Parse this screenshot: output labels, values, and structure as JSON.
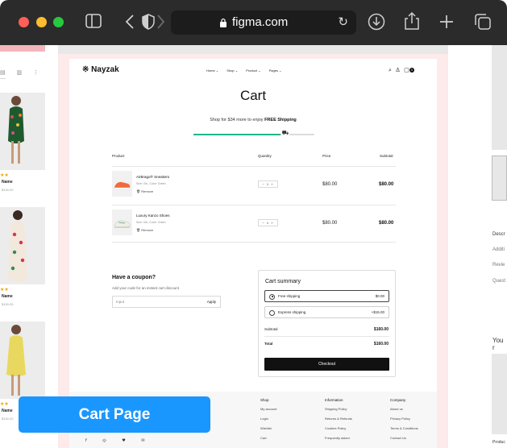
{
  "browser": {
    "url": "figma.com",
    "colors": {
      "close": "#ff5f57",
      "minimize": "#febc2e",
      "zoom": "#28c840"
    },
    "icons": [
      "sidebar-icon",
      "back-icon",
      "shield-icon",
      "forward-icon",
      "lock-icon",
      "reload-icon",
      "download-icon",
      "share-icon",
      "new-tab-icon",
      "tabs-icon"
    ]
  },
  "left_frame": {
    "products": [
      {
        "stars": "★★",
        "name": "Name",
        "price": "$100.00"
      },
      {
        "stars": "★★",
        "name": "Name",
        "price": "$100.00"
      },
      {
        "stars": "★★",
        "name": "Name",
        "price": "$100.00"
      }
    ]
  },
  "header": {
    "logo": "※ Nayzak",
    "nav": [
      "Home ⌄",
      "Shop ⌄",
      "Product ⌄",
      "Pages ⌄"
    ],
    "cart_count": "3"
  },
  "cart": {
    "title": "Cart",
    "shipping_prefix": "Shop for $34 more to enjoy ",
    "shipping_bold": "FREE Shipping",
    "progress": 0.72,
    "columns": [
      "Product",
      "Quantity",
      "Price",
      "Subtotal"
    ],
    "items": [
      {
        "name": "AirBrago® Sneakers",
        "meta": "Size: 04L, Color: Green",
        "remove": "Remove",
        "qty": "− 1 +",
        "price": "$80.00",
        "subtotal": "$80.00"
      },
      {
        "name": "Luxury Kanzo Shoes",
        "meta": "Size: 04L, Color: Green",
        "remove": "Remove",
        "qty": "− 1 +",
        "price": "$80.00",
        "subtotal": "$80.00"
      }
    ]
  },
  "coupon": {
    "title": "Have a coupon?",
    "subtitle": "Add your code for an instant cart discount",
    "placeholder": "Input",
    "apply": "Apply"
  },
  "summary": {
    "title": "Cart summary",
    "options": [
      {
        "label": "Free shipping",
        "value": "$0.00",
        "selected": true
      },
      {
        "label": "Express shipping",
        "value": "+$15.00",
        "selected": false
      }
    ],
    "subtotal_label": "Subtotal",
    "subtotal_value": "$160.00",
    "total_label": "Total",
    "total_value": "$160.00",
    "checkout": "Checkout"
  },
  "footer": {
    "columns": [
      {
        "title": "Shop",
        "links": [
          "My account",
          "Login",
          "Wishlist",
          "Cart"
        ]
      },
      {
        "title": "Information",
        "links": [
          "Shipping Policy",
          "Returns & Refunds",
          "Cookies Policy",
          "Frequently asked"
        ]
      },
      {
        "title": "Company",
        "links": [
          "About us",
          "Privacy Policy",
          "Terms & Conditions",
          "Contact Us"
        ]
      }
    ],
    "social": "f ◎ ♥ ✉"
  },
  "badge": {
    "label": "Cart Page",
    "color": "#1a97ff"
  },
  "right_frame": {
    "texts": [
      "Descr",
      "Additi",
      "Revie",
      "Quest",
      "You r",
      "Produc"
    ]
  }
}
